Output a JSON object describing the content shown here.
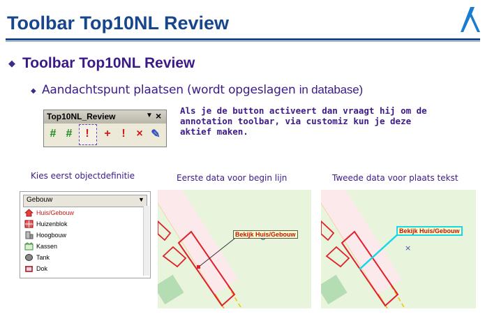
{
  "title": "Toolbar Top10NL Review",
  "bullet1": "Toolbar Top10NL Review",
  "bullet2_main": "Aandachtspunt plaatsen (wordt opgeslagen ",
  "bullet2_tail": "in database)",
  "toolbar": {
    "title": "Top10NL_Review",
    "menu_glyph": "▼",
    "close_glyph": "×",
    "buttons": [
      {
        "icon": "grid-icon",
        "glyph": "#"
      },
      {
        "icon": "grid-check-icon",
        "glyph": "#"
      },
      {
        "icon": "annotation-search-icon",
        "glyph": "!"
      },
      {
        "icon": "add-point-icon",
        "glyph": "+"
      },
      {
        "icon": "flag-point-icon",
        "glyph": "!"
      },
      {
        "icon": "delete-point-icon",
        "glyph": "×"
      },
      {
        "icon": "edit-pencil-icon",
        "glyph": "✎"
      }
    ]
  },
  "note": "Als je de button activeert dan vraagt hij om de annotation toolbar, via customiz kun je deze aktief maken.",
  "captions": {
    "first": "Kies eerst objectdefinitie",
    "second": "Eerste data voor begin lijn",
    "third": "Tweede data voor plaats tekst"
  },
  "legend": {
    "header": "Gebouw",
    "items": [
      {
        "label": "Huis/Gebouw",
        "icon": "house-icon",
        "selected": true
      },
      {
        "label": "Huizenblok",
        "icon": "housing-block-icon",
        "selected": false
      },
      {
        "label": "Hoogbouw",
        "icon": "highrise-icon",
        "selected": false
      },
      {
        "label": "Kassen",
        "icon": "greenhouse-icon",
        "selected": false
      },
      {
        "label": "Tank",
        "icon": "tank-icon",
        "selected": false
      },
      {
        "label": "Dok",
        "icon": "dock-icon",
        "selected": false
      }
    ]
  },
  "map1_label": "Bekijk Huis/Gebouw",
  "map2_label": "Bekijk Huis/Gebouw",
  "colors": {
    "title": "#17468c",
    "heading": "#3b1a88",
    "map_bg": "#e9f4dd",
    "building_outline": "#e0202a",
    "road_line": "#f0a020",
    "leader_line_active": "#18d8e8"
  }
}
